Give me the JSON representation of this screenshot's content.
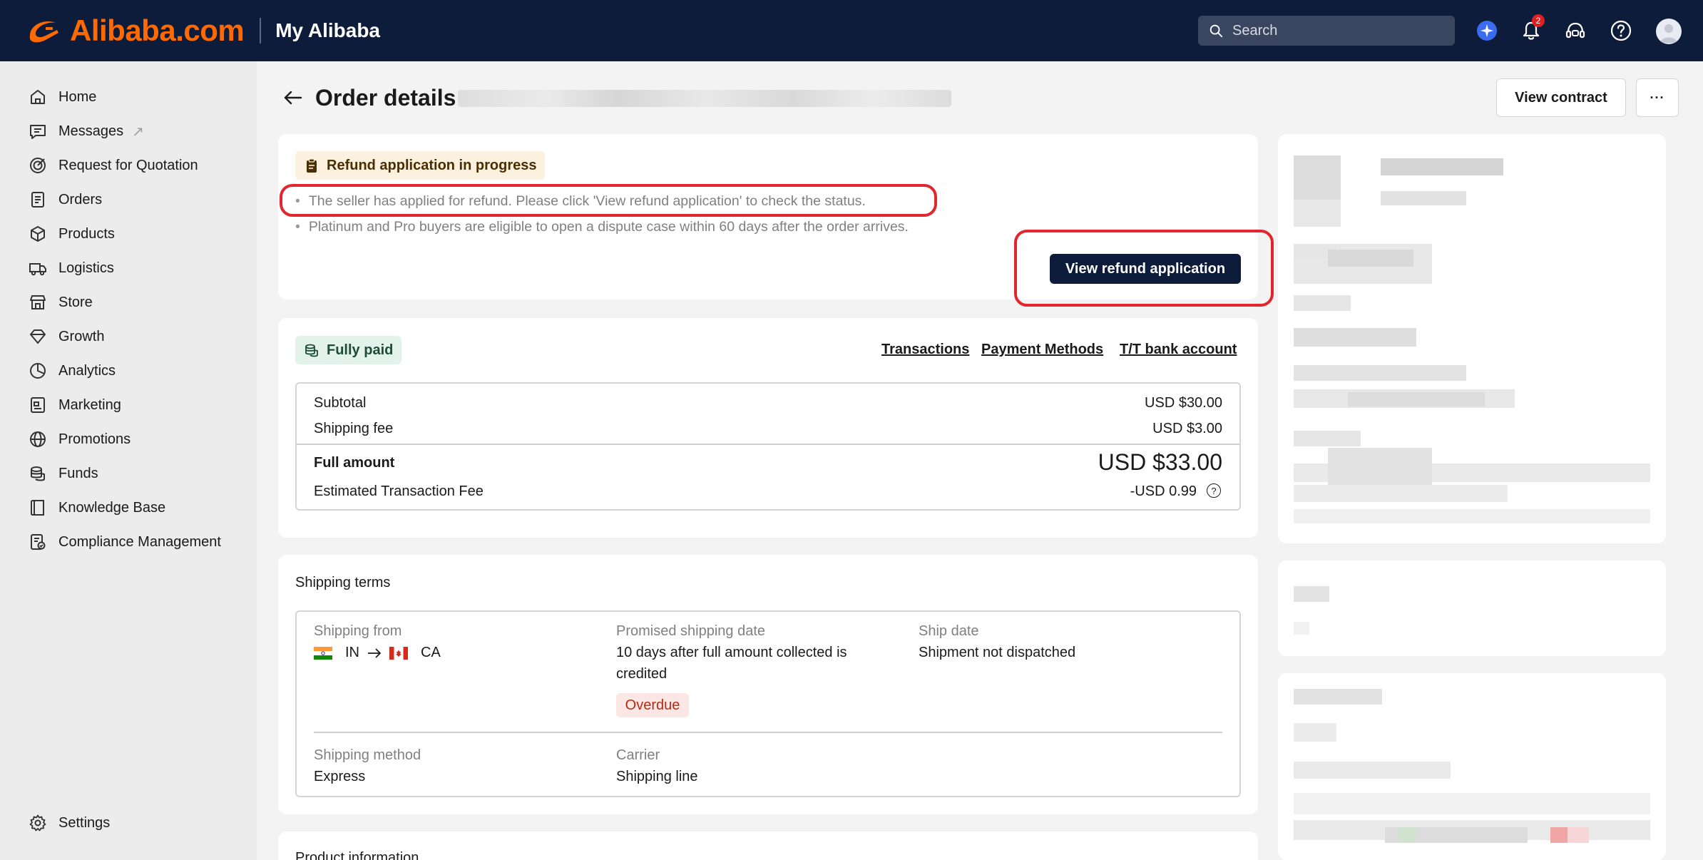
{
  "topbar": {
    "brand": "Alibaba.com",
    "section_title": "My Alibaba",
    "search_placeholder": "Search",
    "notification_count": "2"
  },
  "sidebar": {
    "items": [
      {
        "label": "Home",
        "icon": "home-icon"
      },
      {
        "label": "Messages",
        "icon": "message-icon",
        "external": "↗"
      },
      {
        "label": "Request for Quotation",
        "icon": "target-icon"
      },
      {
        "label": "Orders",
        "icon": "orders-icon"
      },
      {
        "label": "Products",
        "icon": "box-icon"
      },
      {
        "label": "Logistics",
        "icon": "truck-icon"
      },
      {
        "label": "Store",
        "icon": "store-icon"
      },
      {
        "label": "Growth",
        "icon": "diamond-icon"
      },
      {
        "label": "Analytics",
        "icon": "analytics-icon"
      },
      {
        "label": "Marketing",
        "icon": "marketing-icon"
      },
      {
        "label": "Promotions",
        "icon": "globe-icon"
      },
      {
        "label": "Funds",
        "icon": "coins-icon"
      },
      {
        "label": "Knowledge Base",
        "icon": "book-icon"
      },
      {
        "label": "Compliance Management",
        "icon": "compliance-icon"
      }
    ],
    "settings_label": "Settings"
  },
  "header": {
    "title": "Order details",
    "view_contract_label": "View contract",
    "more_label": "···"
  },
  "refund_card": {
    "status_label": "Refund application in progress",
    "bullets": [
      "The seller has applied for refund. Please click 'View refund application' to check the status.",
      "Platinum and Pro buyers are eligible to open a dispute case within 60 days after the order arrives."
    ],
    "action_label": "View refund application"
  },
  "payment_card": {
    "status_label": "Fully paid",
    "links": [
      "Transactions",
      "Payment Methods",
      "T/T bank account"
    ],
    "subtotal_label": "Subtotal",
    "subtotal_value": "USD $30.00",
    "shipping_fee_label": "Shipping fee",
    "shipping_fee_value": "USD $3.00",
    "full_amount_label": "Full amount",
    "full_amount_value": "USD $33.00",
    "tx_fee_label": "Estimated Transaction Fee",
    "tx_fee_value": "-USD 0.99",
    "tx_fee_help": "?"
  },
  "shipping_card": {
    "title": "Shipping terms",
    "from_label": "Shipping from",
    "from_country": "IN",
    "to_country": "CA",
    "promised_label": "Promised shipping date",
    "promised_value_line1": "10 days after full amount collected is",
    "promised_value_line2": "credited",
    "overdue_label": "Overdue",
    "ship_date_label": "Ship date",
    "ship_date_value": "Shipment not dispatched",
    "method_label": "Shipping method",
    "method_value": "Express",
    "carrier_label": "Carrier",
    "carrier_value": "Shipping line"
  },
  "product_card": {
    "title": "Product information"
  },
  "colors": {
    "topbar_bg": "#0e1c3b",
    "brand_orange": "#ff6a00",
    "primary_button": "#0e1c3b",
    "highlight_red": "#e3262d"
  }
}
